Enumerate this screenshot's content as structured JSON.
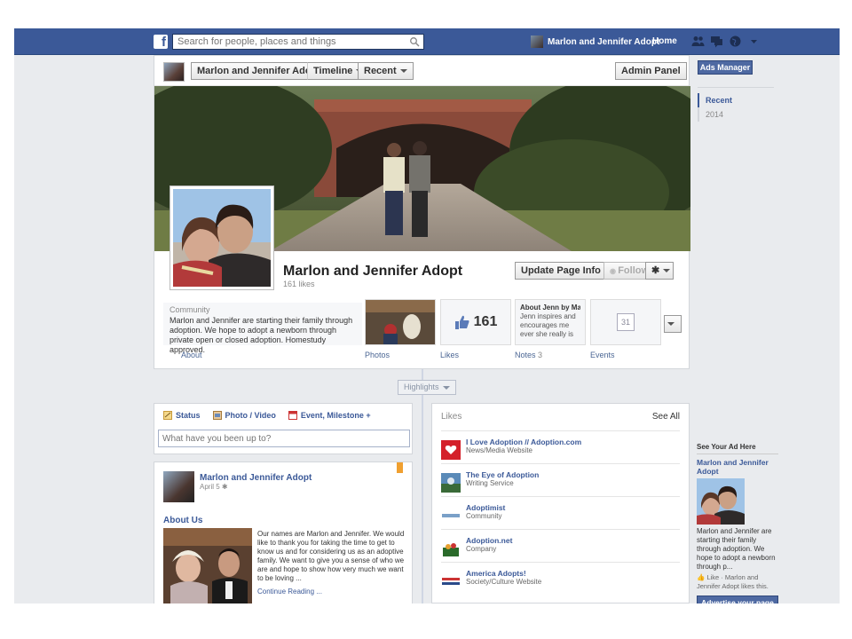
{
  "topbar": {
    "logo": "f",
    "search_placeholder": "Search for people, places and things",
    "user_name": "Marlon and Jennifer Adopt",
    "home_label": "Home"
  },
  "page_header": {
    "name_button": "Marlon and Jennifer Adopt",
    "timeline_label": "Timeline",
    "recent_label": "Recent",
    "admin_panel_label": "Admin Panel"
  },
  "profile": {
    "name": "Marlon and Jennifer Adopt",
    "likes": "161 likes",
    "update_button": "Update Page Info",
    "follow_button": "Follow",
    "category": "Community",
    "about": "Marlon and Jennifer are starting their family through adoption. We hope to adopt a newborn through private open or closed adoption. Homestudy approved."
  },
  "tiles": {
    "about_label": "About",
    "photos_label": "Photos",
    "likes_count": "161",
    "likes_label": "Likes",
    "notes_title": "About Jenn by Ma",
    "notes_preview": "Jenn inspires and encourages me ever she really is my bette",
    "notes_label": "Notes",
    "notes_count": "3",
    "events_day": "31",
    "events_label": "Events"
  },
  "timeline": {
    "highlights_label": "Highlights"
  },
  "right_nav": {
    "ads_manager": "Ads Manager",
    "recent": "Recent",
    "year": "2014"
  },
  "composer": {
    "status_tab": "Status",
    "photo_tab": "Photo / Video",
    "event_tab": "Event, Milestone +",
    "placeholder": "What have you been up to?"
  },
  "post": {
    "author": "Marlon and Jennifer Adopt",
    "date": "April 5",
    "heading": "About Us",
    "text": "Our names are Marlon and Jennifer. We would like to thank you for taking the time to get to know us and for considering us as an adoptive family. We want to give you a sense of who we are and hope to show how very much we want to be loving ...",
    "continue": "Continue Reading ..."
  },
  "likes_panel": {
    "title": "Likes",
    "see_all": "See All",
    "items": [
      {
        "name": "I Love Adoption // Adoption.com",
        "category": "News/Media Website"
      },
      {
        "name": "The Eye of Adoption",
        "category": "Writing Service"
      },
      {
        "name": "Adoptimist",
        "category": "Community"
      },
      {
        "name": "Adoption.net",
        "category": "Company"
      },
      {
        "name": "America Adopts!",
        "category": "Society/Culture Website"
      }
    ]
  },
  "ad": {
    "header": "See Your Ad Here",
    "title": "Marlon and Jennifer Adopt",
    "body": "Marlon and Jennifer are starting their family through adoption. We hope to adopt a newborn through p...",
    "like_line": "Like · Marlon and Jennifer Adopt likes this.",
    "advertise_button": "Advertise your page"
  },
  "colors": {
    "brand": "#3b5998",
    "background": "#e9ebee",
    "link": "#3b5998"
  }
}
